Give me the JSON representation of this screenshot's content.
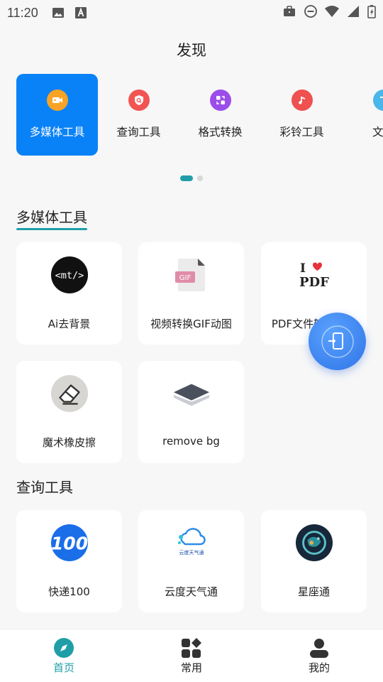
{
  "status_bar": {
    "time": "11:20",
    "left_icons": [
      "image-icon",
      "text-a-icon"
    ],
    "right_icons": [
      "briefcase-icon",
      "do-not-disturb-icon",
      "wifi-icon",
      "cell-signal-icon",
      "battery-charging-icon"
    ]
  },
  "header": {
    "title": "发现"
  },
  "categories": [
    {
      "label": "多媒体工具",
      "icon": "video-camera-icon",
      "color": "#f7a325",
      "active": true
    },
    {
      "label": "查询工具",
      "icon": "search-shield-icon",
      "color": "#f25454"
    },
    {
      "label": "格式转换",
      "icon": "convert-icon",
      "color": "#9b4dea"
    },
    {
      "label": "彩铃工具",
      "icon": "music-note-icon",
      "color": "#ef5050"
    },
    {
      "label": "文字",
      "icon": "text-icon",
      "color": "#4ab6ea"
    }
  ],
  "pager": {
    "active_index": 0,
    "count": 2
  },
  "sections": {
    "multimedia": {
      "title": "多媒体工具",
      "items": [
        {
          "label": "Ai去背景",
          "icon": "mt-code-icon"
        },
        {
          "label": "视频转换GIF动图",
          "icon": "gif-file-icon"
        },
        {
          "label": "PDF文件转换工具",
          "icon": "i-love-pdf-icon",
          "logo_text": "PDF"
        },
        {
          "label": "魔术橡皮擦",
          "icon": "eraser-icon"
        },
        {
          "label": "remove bg",
          "icon": "layers-icon"
        }
      ]
    },
    "query": {
      "title": "查询工具",
      "items": [
        {
          "label": "快递100",
          "icon": "kuaidi100-icon",
          "logo_text": "100"
        },
        {
          "label": "云度天气通",
          "icon": "cloud-weather-icon",
          "logo_text": "云度天气通"
        },
        {
          "label": "星座通",
          "icon": "zodiac-icon"
        }
      ]
    }
  },
  "fab": {
    "icon": "phone-transfer-icon"
  },
  "bottom_nav": [
    {
      "label": "首页",
      "icon": "compass-icon",
      "active": true
    },
    {
      "label": "常用",
      "icon": "apps-grid-icon"
    },
    {
      "label": "我的",
      "icon": "user-icon"
    }
  ],
  "colors": {
    "accent": "#1f9ea8",
    "active_tab_bg": "#0a82f7",
    "fab": "#3f86f0"
  }
}
